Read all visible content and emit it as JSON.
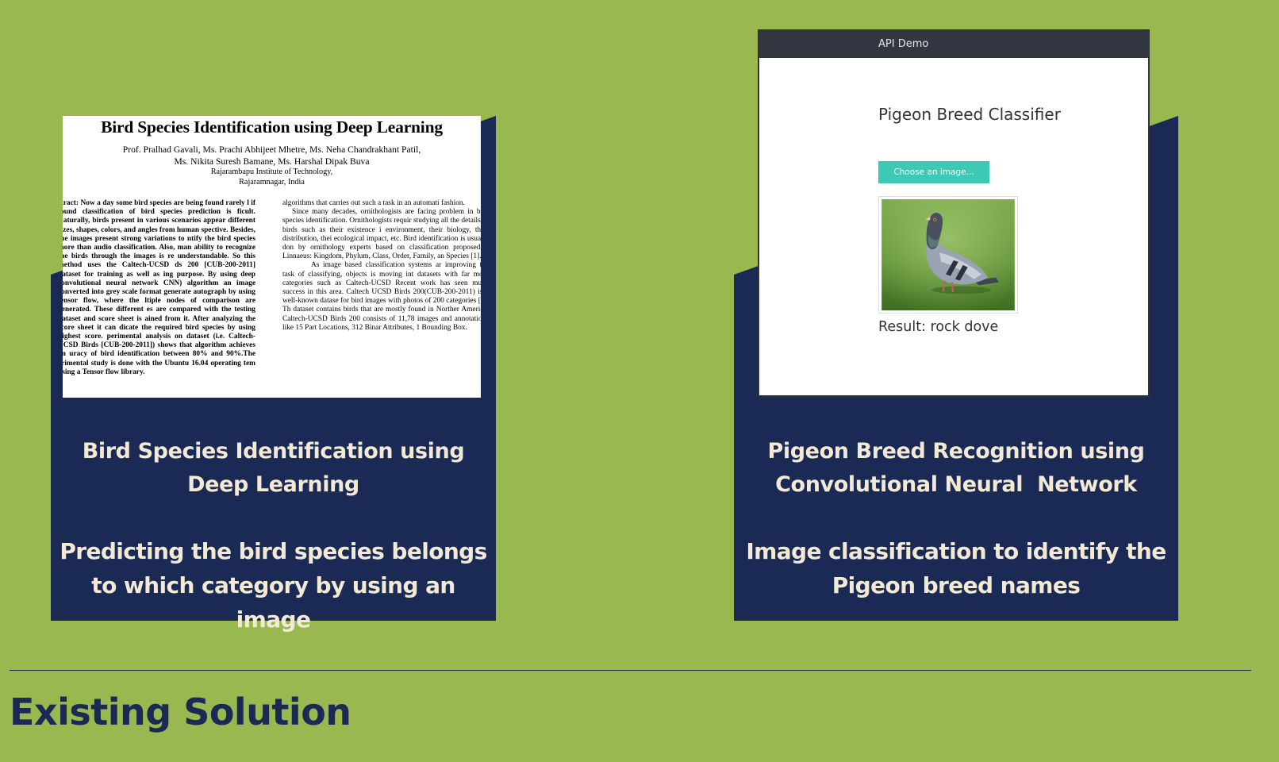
{
  "cards": [
    {
      "title_lines": [
        "Bird Species Identification using",
        "Deep Learning"
      ],
      "desc_lines": [
        "Predicting the bird species belongs",
        "to which category by using an image"
      ]
    },
    {
      "title_lines": [
        "Pigeon Breed Recognition using",
        "Convolutional Neural  Network"
      ],
      "desc_lines": [
        "Image classification to identify the",
        "Pigeon breed names"
      ]
    }
  ],
  "paper": {
    "title": "Bird Species Identification using Deep Learning",
    "authors_line1": "Prof. Pralhad Gavali, Ms. Prachi Abhijeet Mhetre, Ms. Neha Chandrakhant Patil,",
    "authors_line2": "Ms. Nikita Suresh Bamane, Ms. Harshal Dipak Buva",
    "institute": "Rajarambapu Institute of Technology,",
    "location": "Rajaramnagar, India",
    "left_column": "stract: Now a day some bird species are being found rarely l if found classification of bird species prediction is ficult. Naturally, birds present in various scenarios appear different sizes, shapes, colors, and angles from human spective. Besides, the images present strong variations to ntify the bird species more than audio classification. Also, man ability to recognize the birds through the images is re understandable. So this method uses the Caltech-UCSD ds 200 [CUB-200-2011] dataset for training as well as ing purpose. By using deep convolutional neural network CNN) algorithm an image converted into grey scale format generate autograph by using tensor flow, where the ltiple nodes of comparison are generated. These different es are compared with the testing dataset and score sheet is ained from it. After analyzing the score sheet it can dicate the required bird species by using highest score. perimental analysis on dataset (i.e. Caltech-UCSD Birds [CUB-200-2011]) shows that algorithm achieves an uracy of bird identification between 80% and 90%.The erimental study is done with the Ubuntu 16.04 operating tem using a Tensor flow library.",
    "right_column_p1": "algorithms that carries out such a task in an automati fashion.",
    "right_column_p2": "Since many decades, ornithologists are facing problem in bird species identification. Ornithologists requir studying all the details of birds such as their existence i environment, their biology, their distribution, thei ecological impact, etc. Bird identification is usually don by ornithology experts based on classification proposed b Linnaeus: Kingdom, Phylum, Class, Order, Family, an Species [1].",
    "right_column_p3": "As image based classification systems ar improving the task of classifying, objects is moving int datasets with far more categories such as Caltech-UCSD Recent work has seen much success in this area. Caltech UCSD Birds 200(CUB-200-2011) is a well-known datase for bird images with photos of 200 categories [4]. Th dataset contains birds that are mostly found in Norther America. Caltech-UCSD Birds 200 consists of 11,78 images and annotations like 15 Part Locations, 312 Binar Attributes, 1 Bounding Box."
  },
  "demo": {
    "bar_title": "API Demo",
    "heading": "Pigeon Breed Classifier",
    "button_label": "Choose an image...",
    "result_text": "Result: rock dove"
  },
  "section_title": "Existing Solution",
  "colors": {
    "background": "#9ab850",
    "card": "#1a2a55",
    "card_text": "#f3ead6",
    "accent_button": "#3ec9b5"
  }
}
